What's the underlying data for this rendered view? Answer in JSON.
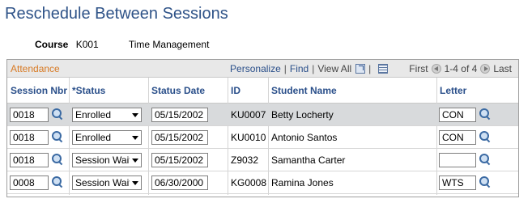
{
  "page": {
    "title": "Reschedule Between Sessions"
  },
  "course": {
    "label": "Course",
    "code": "K001",
    "name": "Time Management"
  },
  "grid": {
    "title": "Attendance",
    "nav": {
      "personalize": "Personalize",
      "find": "Find",
      "view_all": "View All",
      "first": "First",
      "range": "1-4 of 4",
      "last": "Last"
    },
    "columns": {
      "session_nbr": "Session Nbr",
      "status": "*Status",
      "status_date": "Status Date",
      "id": "ID",
      "student_name": "Student Name",
      "letter": "Letter"
    },
    "rows": [
      {
        "session_nbr": "0018",
        "status": "Enrolled",
        "status_date": "05/15/2002",
        "id": "KU0007",
        "student_name": "Betty Locherty",
        "letter": "CON"
      },
      {
        "session_nbr": "0018",
        "status": "Enrolled",
        "status_date": "05/15/2002",
        "id": "KU0010",
        "student_name": "Antonio Santos",
        "letter": "CON"
      },
      {
        "session_nbr": "0018",
        "status": "Session Wait",
        "status_date": "05/15/2002",
        "id": "Z9032",
        "student_name": "Samantha Carter",
        "letter": ""
      },
      {
        "session_nbr": "0008",
        "status": "Session Wait",
        "status_date": "06/30/2000",
        "id": "KG0008",
        "student_name": "Ramina Jones",
        "letter": "WTS"
      }
    ]
  }
}
